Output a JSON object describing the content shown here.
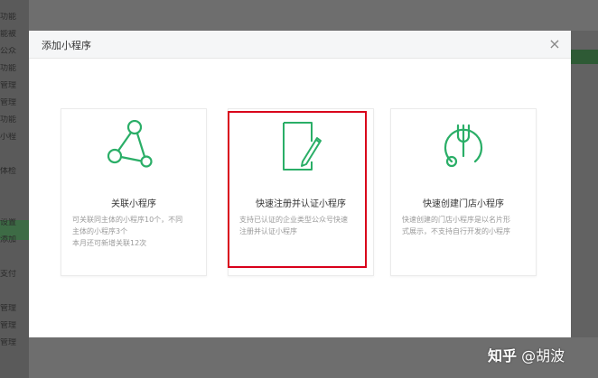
{
  "background": {
    "sidebar_fragments": [
      "功能",
      "能被",
      "公众",
      "功能",
      "管理",
      "管理",
      "功能",
      "小程",
      "",
      "体检",
      "",
      "",
      "设置",
      "添加",
      "",
      "支付",
      "",
      "管理",
      "管理",
      "管理"
    ]
  },
  "modal": {
    "title": "添加小程序",
    "close_glyph": "×",
    "cards": [
      {
        "title": "关联小程序",
        "desc_lines": [
          "可关联同主体的小程序10个，不同",
          "主体的小程序3个",
          "本月还可新增关联12次"
        ],
        "icon": "share-nodes-icon"
      },
      {
        "title": "快速注册并认证小程序",
        "desc_lines": [
          "支持已认证的企业类型公众号快速",
          "注册并认证小程序"
        ],
        "icon": "document-edit-icon"
      },
      {
        "title": "快速创建门店小程序",
        "desc_lines": [
          "快速创建的门店小程序是以名片形",
          "式展示，不支持自行开发的小程序"
        ],
        "icon": "store-fork-icon"
      }
    ]
  },
  "watermark": {
    "logo": "知乎",
    "author": "@胡波"
  },
  "colors": {
    "accent_green": "#2aae67",
    "highlight_red": "#d9001b"
  }
}
